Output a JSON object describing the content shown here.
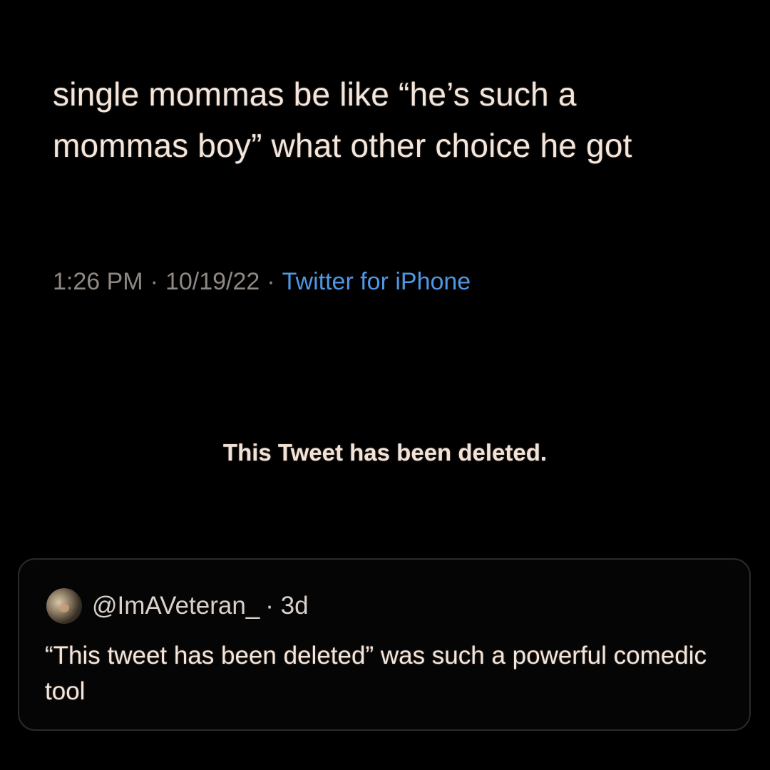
{
  "tweet": {
    "text": "single mommas be like “he’s such a mommas boy” what other choice he got",
    "time": "1:26 PM",
    "date": "10/19/22",
    "separator": "·",
    "source": "Twitter for iPhone"
  },
  "deleted_notice": "This Tweet has been deleted.",
  "quoted_tweet": {
    "avatar_icon": "user-avatar-icon",
    "handle": "@ImAVeteran_",
    "age": "· 3d",
    "text": "“This tweet has been deleted” was such a powerful comedic tool"
  },
  "colors": {
    "background": "#000000",
    "text": "#f3e6dc",
    "meta": "#8f8781",
    "link": "#4f97e3",
    "card_border": "#2b2a29"
  }
}
